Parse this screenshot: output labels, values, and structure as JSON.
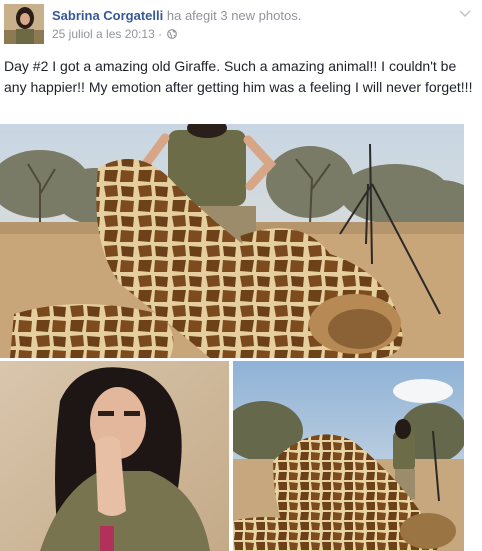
{
  "post": {
    "author": "Sabrina Corgatelli",
    "action": "ha afegit 3 new photos.",
    "timestamp": "25 juliol a les 20:13",
    "separator": "·",
    "privacy_icon": "globe-icon",
    "menu_icon": "chevron-down-icon",
    "text": "Day #2 I got a amazing old Giraffe. Such a amazing animal!! I couldn't be any happier!! My emotion after getting him was a feeling I will never forget!!!"
  },
  "photos": [
    {
      "subject": "woman posing with giraffe"
    },
    {
      "subject": "woman with hands together"
    },
    {
      "subject": "woman posing with giraffe"
    }
  ],
  "colors": {
    "link": "#365899",
    "meta": "#90949c",
    "text": "#1d2129"
  }
}
